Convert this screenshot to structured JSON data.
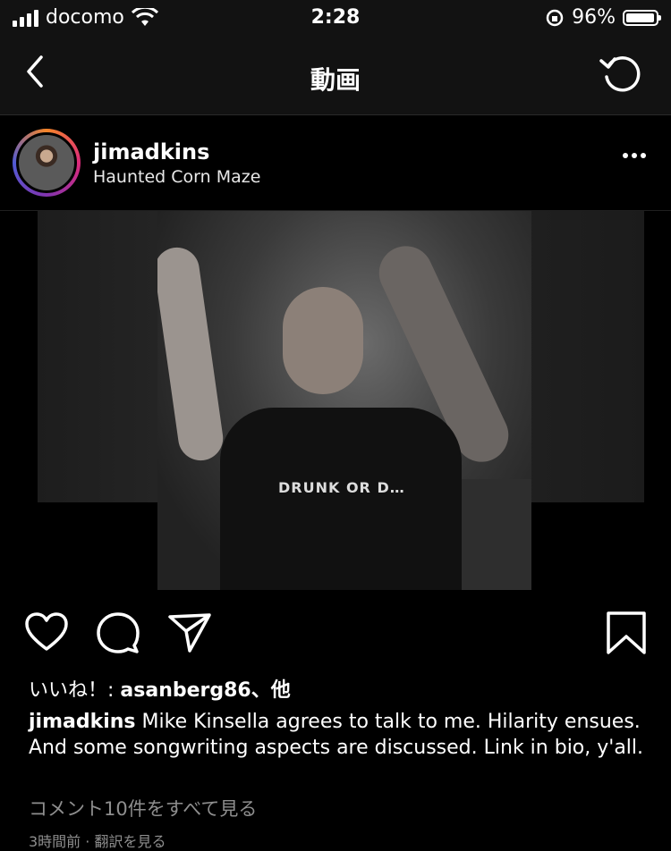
{
  "status_bar": {
    "carrier": "docomo",
    "time": "2:28",
    "battery_percent": "96%",
    "battery_level": 0.96
  },
  "nav": {
    "title": "動画",
    "back_icon": "chevron-left-icon",
    "refresh_icon": "refresh-icon"
  },
  "post": {
    "username": "jimadkins",
    "location": "Haunted Corn Maze",
    "video_shirt_text": "DRUNK OR D…",
    "likes_prefix": "いいね！: ",
    "likes_user": "asanberg86",
    "likes_suffix": "、他",
    "caption_user": "jimadkins",
    "caption_text": " Mike Kinsella agrees to talk to me. Hilarity ensues. And some songwriting aspects are discussed. Link in bio, y'all.",
    "comments_link": "コメント10件をすべて見る",
    "time_row": "3時間前 · 翻訳を見る"
  },
  "colors": {
    "bar_bg": "#121212",
    "muted_text": "#8e8e8e"
  }
}
